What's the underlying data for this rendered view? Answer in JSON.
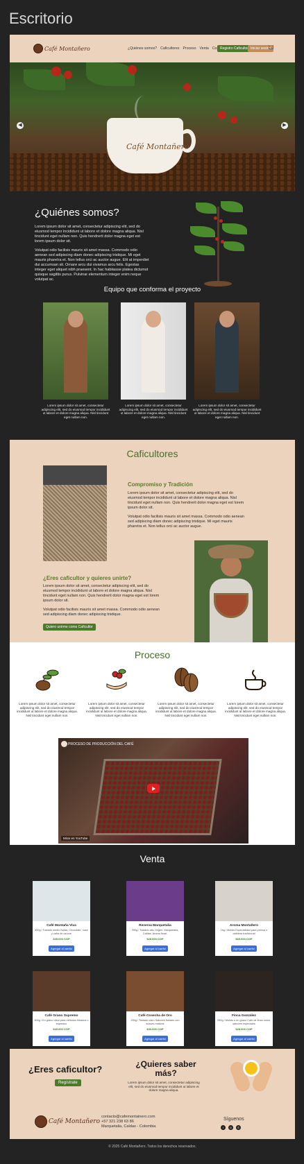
{
  "window": {
    "title": "Escritorio"
  },
  "nav": {
    "logo_text": "Café Montañero",
    "menu": [
      "¿Quiénes somos?",
      "Caficultores",
      "Proceso",
      "Venta",
      "Contacto"
    ],
    "register_label": "Registro Caficultores",
    "login_label": "Iniciar sesión",
    "cart_icon": "cart-icon"
  },
  "hero": {
    "cup_logo": "Café Montañero",
    "prev_icon": "chevron-left-icon",
    "next_icon": "chevron-right-icon"
  },
  "about": {
    "title": "¿Quiénes somos?",
    "p1": "Lorem ipsum dolor sit amet, consectetur adipiscing elit, sed do eiusmod tempor incididunt ut labore et dolore magna aliqua. Nisl tincidunt eget nullam non. Quis hendrerit dolor magna eget est lorem ipsum dolor sit.",
    "p2": "Volutpat odio facilisis mauris sit amet massa. Commodo odio aenean sed adipiscing diam donec adipiscing tristique. Mi eget mauris pharetra et. Non tellus orci ac auctor augue. Elit at imperdiet dui accumsan sit. Ornare arcu dui vivamus arcu felis. Egestas integer eget aliquet nibh praesent. In hac habitasse platea dictumst quisque sagittis purus. Pulvinar elementum integer enim neque volutpat ac.",
    "team_title": "Equipo que conforma el proyecto",
    "team": [
      {
        "caption": "Lorem ipsum dolor sit amet, consectetur adipiscing elit, sed do eiusmod tempor incididunt ut labore et dolore magna aliqua. Nisl tincidunt eget nullam non."
      },
      {
        "caption": "Lorem ipsum dolor sit amet, consectetur adipiscing elit, sed do eiusmod tempor incididunt ut labore et dolore magna aliqua. Nisl tincidunt eget nullam non."
      },
      {
        "caption": "Lorem ipsum dolor sit amet, consectetur adipiscing elit, sed do eiusmod tempor incididunt ut labore et dolore magna aliqua. Nisl tincidunt eget nullam non."
      }
    ]
  },
  "caficultores": {
    "title": "Caficultores",
    "h1": "Compromiso y Tradición",
    "t1a": "Lorem ipsum dolor sit amet, consectetur adipiscing elit, sed do eiusmod tempor incididunt ut labore et dolore magna aliqua. Nisl tincidunt eget nullam non. Quis hendrerit dolor magna eget est lorem ipsum dolor sit.",
    "t1b": "Volutpat odio facilisis mauris sit amet massa. Commodo odio aenean sed adipiscing diam donec adipiscing tristique. Mi eget mauris pharetra et. Non tellus orci ac auctor augue.",
    "h2": "¿Eres caficultor y quieres unirte?",
    "t2a": "Lorem ipsum dolor sit amet, consectetur adipiscing elit, sed do eiusmod tempor incididunt ut labore et dolore magna aliqua. Nisl tincidunt eget nullam non. Quis hendrerit dolor magna eget est lorem ipsum dolor sit.",
    "t2b": "Volutpat odio facilisis mauris sit amet massa. Commodo odio aenean sed adipiscing diam donec adipiscing tristique.",
    "join_label": "Quiero unirme como Caficultor"
  },
  "proceso": {
    "title": "Proceso",
    "steps": [
      {
        "icon": "coffee-plant-icon",
        "caption": "Lorem ipsum dolor sit amet, consectetur adipiscing elit, sed do eiusmod tempor incididunt ut labore et dolore magna aliqua. Nisl tincidunt eget nullam non."
      },
      {
        "icon": "hand-harvest-icon",
        "caption": "Lorem ipsum dolor sit amet, consectetur adipiscing elit, sed do eiusmod tempor incididunt ut labore et dolore magna aliqua. Nisl tincidunt eget nullam non."
      },
      {
        "icon": "coffee-beans-icon",
        "caption": "Lorem ipsum dolor sit amet, consectetur adipiscing elit, sed do eiusmod tempor incididunt ut labore et dolore magna aliqua. Nisl tincidunt eget nullam non."
      },
      {
        "icon": "coffee-cup-icon",
        "caption": "Lorem ipsum dolor sit amet, consectetur adipiscing elit, sed do eiusmod tempor incididunt ut labore et dolore magna aliqua. Nisl tincidunt eget nullam non."
      }
    ],
    "video_title": "PROCESO DE PRODUCCIÓN DEL CAFÉ",
    "video_watch": "Mirar en YouTube"
  },
  "venta": {
    "title": "Venta",
    "add_label": "Agregar al carrito",
    "products": [
      {
        "name": "Café Montaña Viva",
        "sub": "500g / Tostado medio\nNotas: Chocolate, nuez y caña de azúcar",
        "price": "$35.000 COP",
        "img": "#dfe6ea"
      },
      {
        "name": "Reserva Marquetalia",
        "sub": "250g / Tostado alto\nOrigen: Marquetalia, Caldas. Aroma floral.",
        "price": "$28.000 COP",
        "img": "#6a3c8a"
      },
      {
        "name": "Aroma Montañero",
        "sub": "1kg / Molido\nEspecialidad para prensa o cafetera tradicional",
        "price": "$60.000 COP",
        "img": "#d7d2cc"
      },
      {
        "name": "Café Grano Supremo",
        "sub": "500g / En grano\nIdeal para métodos filtrados o espresso",
        "price": "$40.000 COP",
        "img": "#5a3a28"
      },
      {
        "name": "Café Cosecha de Oro",
        "sub": "250g / Tostado claro\nSabores frutales con suaves matices",
        "price": "$30.000 COP",
        "img": "#7a4c30"
      },
      {
        "name": "Finca González",
        "sub": "250g / Molido o en grano\nCafé de finca única, sabores especiales",
        "price": "$28.000 COP",
        "img": "#2c2420"
      }
    ]
  },
  "cta": {
    "q1": "¿Eres caficultor?",
    "register": "Regístrate",
    "q2": "¿Quieres saber más?",
    "q2_text": "Lorem ipsum dolor sit amet, consectetur adipiscing elit, sed do eiusmod tempor incididunt ut labore et dolore magna aliqua.",
    "email": "contacto@cafemontainero.com",
    "phone": "+57 321 238 63 86",
    "city": "Marquetalia, Caldas - Colombia",
    "follow": "Síguenos",
    "social": [
      "facebook-icon",
      "instagram-icon",
      "whatsapp-icon"
    ]
  },
  "footer": {
    "text": "© 2025 Café Montañero. Todos los derechos reservados."
  },
  "colors": {
    "beige": "#ecd3bd",
    "green": "#4a6b2a",
    "dark": "#232323",
    "blue": "#3a6fd8"
  }
}
